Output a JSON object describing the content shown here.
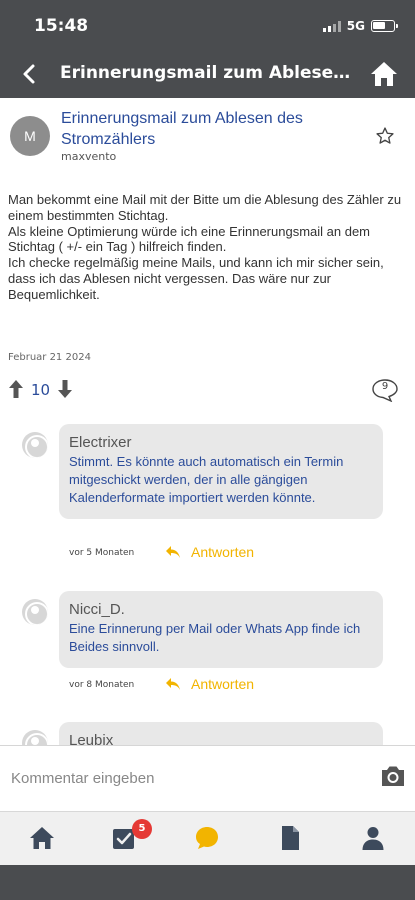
{
  "status_bar": {
    "time": "15:48",
    "network": "5G"
  },
  "header": {
    "title": "Erinnerungsmail zum Ablesen des Stromzählers",
    "back_icon": "chevron-left-icon",
    "home_icon": "home-icon"
  },
  "post": {
    "avatar_letter": "M",
    "title": "Erinnerungsmail zum Ablesen des Stromzählers",
    "author": "maxvento",
    "body": "Man bekommt eine Mail mit der Bitte um die Ablesung des Zähler zu einem bestimmten Stichtag.\nAls kleine Optimierung würde ich eine Erinnerungsmail an dem Stichtag ( +/- ein Tag ) hilfreich finden.\nIch checke regelmäßig meine Mails, und kann ich mir sicher sein, dass ich das Ablesen nicht vergessen. Das wäre nur zur Bequemlichkeit.",
    "date": "Februar 21 2024",
    "votes": "10",
    "comment_count": "9"
  },
  "comments": [
    {
      "name": "Electrixer",
      "text": "Stimmt. Es könnte auch automatisch ein Termin mitgeschickt werden, der in alle gängigen Kalenderformate importiert werden könnte.",
      "time": "vor 5 Monaten",
      "reply": "Antworten"
    },
    {
      "name": "Nicci_D.",
      "text": "Eine Erinnerung per Mail oder Whats App finde ich Beides sinnvoll.",
      "time": "vor 8 Monaten",
      "reply": "Antworten"
    },
    {
      "name": "Leubix",
      "text": "",
      "time": "",
      "reply": ""
    }
  ],
  "composer": {
    "placeholder": "Kommentar eingeben"
  },
  "tabbar": {
    "badge": "5"
  },
  "colors": {
    "dark_bar": "#4a4c4f",
    "link_blue": "#2b4c9a",
    "accent_yellow": "#f2b400",
    "badge_red": "#e53935"
  }
}
